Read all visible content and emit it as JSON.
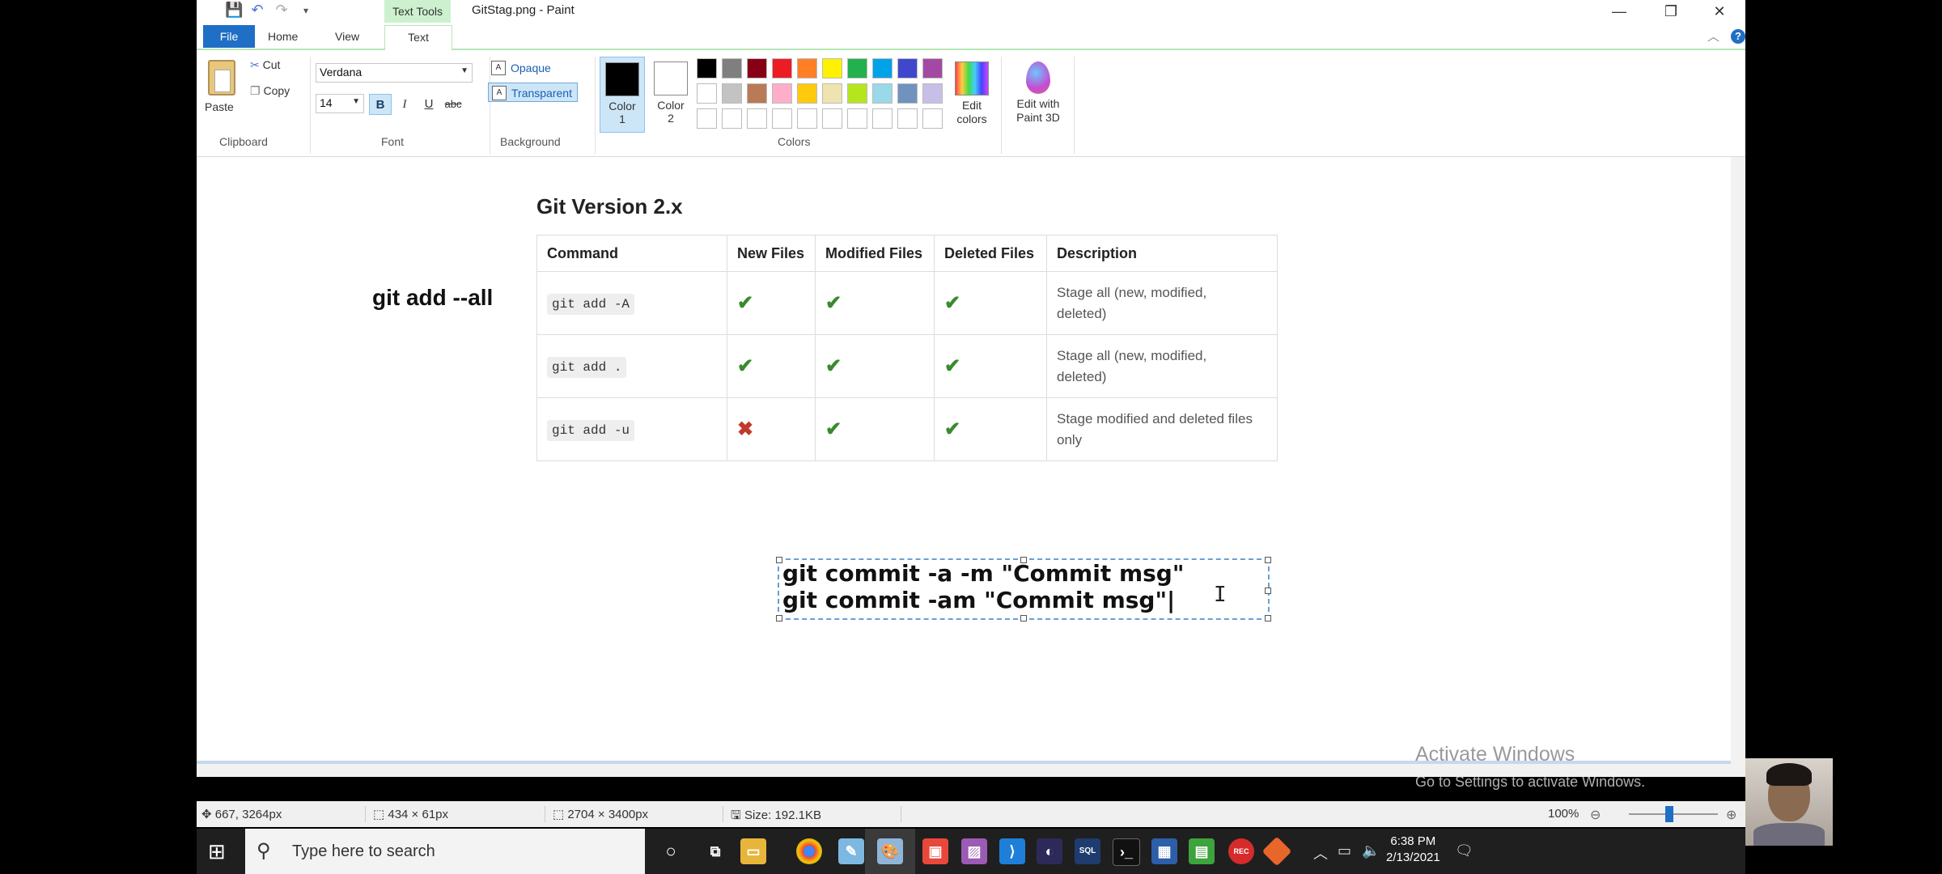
{
  "window": {
    "title": "GitStag.png - Paint",
    "context_tab": "Text Tools"
  },
  "tabs": [
    {
      "label": "File"
    },
    {
      "label": "Home"
    },
    {
      "label": "View"
    },
    {
      "label": "Text"
    }
  ],
  "ribbon": {
    "clipboard": {
      "paste": "Paste",
      "cut": "Cut",
      "copy": "Copy",
      "group": "Clipboard"
    },
    "font": {
      "family": "Verdana",
      "size": "14",
      "bold": "B",
      "italic": "I",
      "underline": "U",
      "strike": "abc",
      "group": "Font"
    },
    "background": {
      "opaque": "Opaque",
      "transparent": "Transparent",
      "group": "Background"
    },
    "colors": {
      "color1": "Color 1",
      "color2": "Color 2",
      "edit": "Edit colors",
      "group": "Colors",
      "color1_value": "#000000",
      "color2_value": "#ffffff",
      "palette_row1": [
        "#000000",
        "#7f7f7f",
        "#880015",
        "#ed1c24",
        "#ff7f27",
        "#fff200",
        "#22b14c",
        "#00a2e8",
        "#3f48cc",
        "#a349a4"
      ],
      "palette_row2": [
        "#ffffff",
        "#c3c3c3",
        "#b97a57",
        "#ffaec9",
        "#ffc90e",
        "#efe4b0",
        "#b5e61d",
        "#99d9ea",
        "#7092be",
        "#c8bfe7"
      ]
    },
    "paint3d": "Edit with Paint 3D"
  },
  "canvas": {
    "heading": "Git Version 2.x",
    "side_label": "git add --all",
    "table": {
      "headers": [
        "Command",
        "New Files",
        "Modified Files",
        "Deleted Files",
        "Description"
      ],
      "rows": [
        {
          "cmd": "git add -A",
          "new": "✔",
          "mod": "✔",
          "del": "✔",
          "desc1": "Stage all (new, modified,",
          "desc2": "deleted)"
        },
        {
          "cmd": "git add .",
          "new": "✔",
          "mod": "✔",
          "del": "✔",
          "desc1": "Stage all (new, modified,",
          "desc2": "deleted)"
        },
        {
          "cmd": "git add -u",
          "new": "✖",
          "mod": "✔",
          "del": "✔",
          "desc1": "Stage modified and deleted files",
          "desc2": "only"
        }
      ]
    },
    "textbox": {
      "line1": "git commit -a -m \"Commit msg\"",
      "line2": "git commit -am \"Commit msg\"|"
    },
    "watermark1": "Activate Windows",
    "watermark2": "Go to Settings to activate Windows."
  },
  "status": {
    "cursor": "667, 3264px",
    "selection": "434 × 61px",
    "image_size": "2704 × 3400px",
    "file_size": "Size: 192.1KB",
    "zoom": "100%"
  },
  "taskbar": {
    "search_placeholder": "Type here to search",
    "time": "6:38 PM",
    "date": "2/13/2021"
  }
}
